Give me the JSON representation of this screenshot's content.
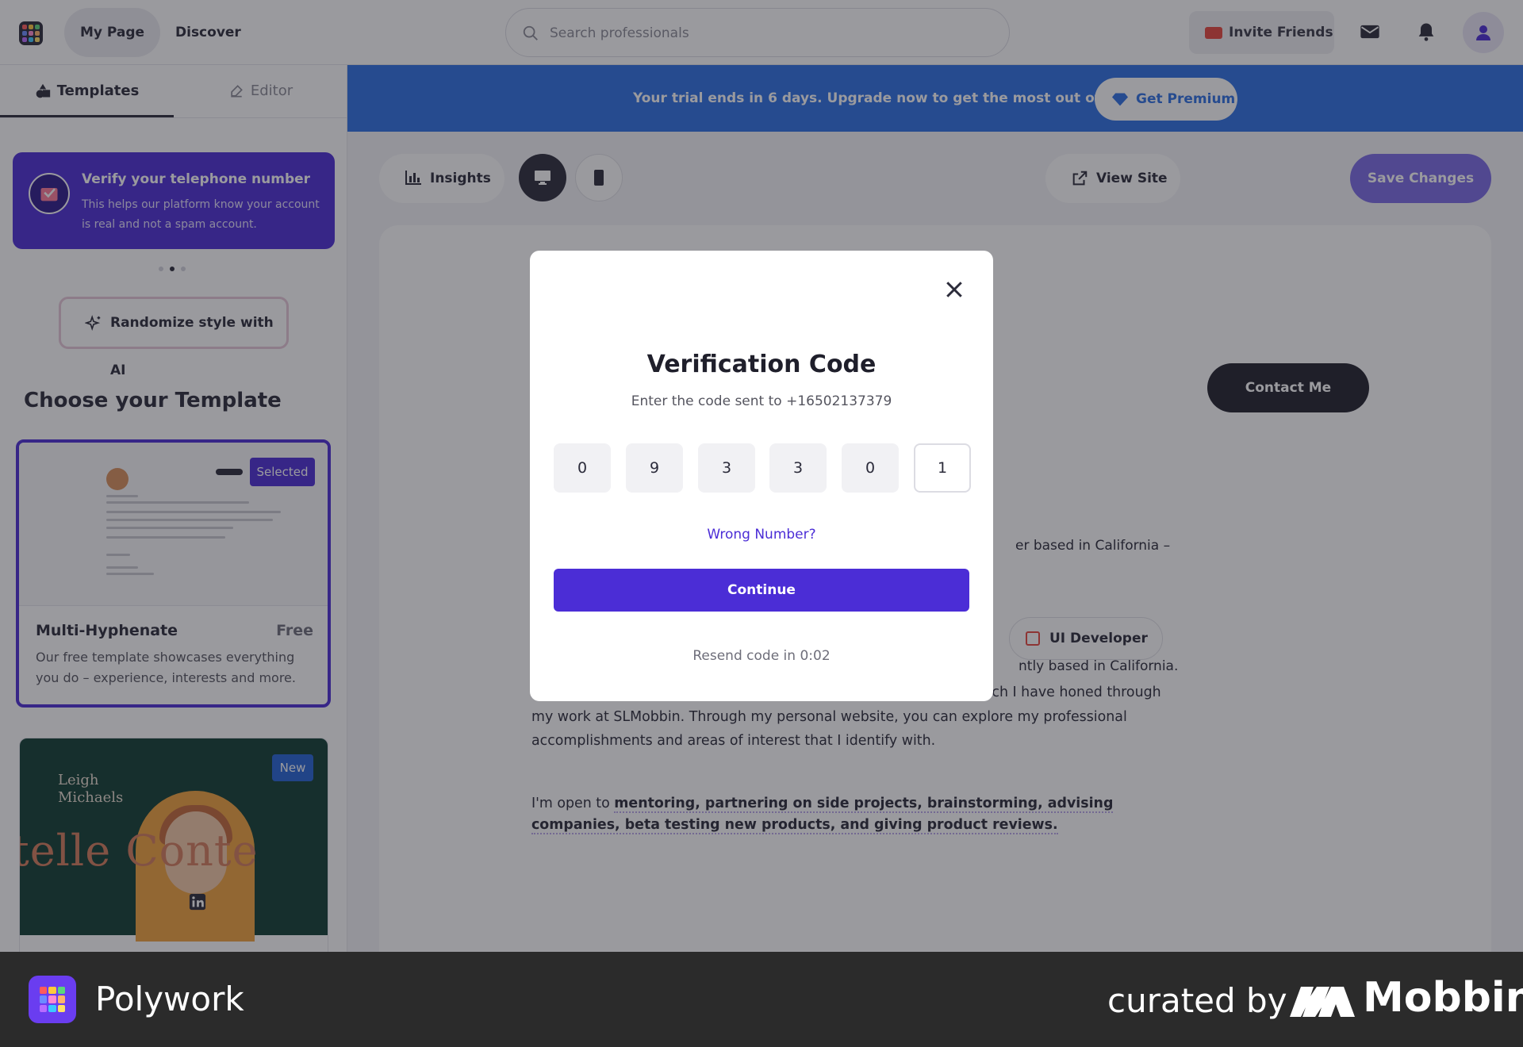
{
  "topbar": {
    "nav": [
      "My Page",
      "Discover"
    ],
    "search_placeholder": "Search professionals",
    "invite_label": "Invite Friends",
    "icons": [
      "mail-icon",
      "bell-icon",
      "user-avatar-icon"
    ]
  },
  "sidebar": {
    "tabs": [
      "Templates",
      "Editor"
    ],
    "verify_card": {
      "title": "Verify your telephone number",
      "text": "This helps our platform know your account is real and not a spam account."
    },
    "ai_button": "Randomize style with AI",
    "choose_title": "Choose your Template",
    "template_1": {
      "badge": "Selected",
      "name": "Multi-Hyphenate",
      "price": "Free",
      "description": "Our free template showcases everything you do – experience, interests and more."
    },
    "template_2": {
      "badge": "New",
      "preview_name": "Leigh Michaels",
      "preview_big": "telle Conte"
    }
  },
  "banner": {
    "text": "Your trial ends in 6 days. Upgrade now to get the most out of your site",
    "premium": "Get Premium"
  },
  "toolbar": {
    "insights": "Insights",
    "view_site": "View Site",
    "save": "Save Changes"
  },
  "profile": {
    "contact": "Contact Me",
    "partial_line": "er based in California –",
    "chip": "UI Developer",
    "partial_line2": "ntly based in California.",
    "bio": "My expertise lies in Product Design, UI Design, and UX Design, which I have honed through my work at SLMobbin. Through my personal website, you can explore my professional accomplishments and areas of interest that I identify with.",
    "open_to_prefix": "I'm open to ",
    "open_to_items": "mentoring, partnering on side projects, brainstorming, advising companies, beta testing new products, and giving product reviews."
  },
  "modal": {
    "title": "Verification Code",
    "subtitle": "Enter the code sent to +16502137379",
    "code": [
      "0",
      "9",
      "3",
      "3",
      "0",
      "1"
    ],
    "wrong_number": "Wrong Number?",
    "continue": "Continue",
    "resend": "Resend code in 0:02"
  },
  "footer": {
    "brand": "Polywork",
    "curated_by": "curated by",
    "mobbin": "Mobbin"
  },
  "colors": {
    "accent": "#4b2dd6",
    "banner": "#2d6fe3",
    "dark": "#1f1f2b"
  }
}
